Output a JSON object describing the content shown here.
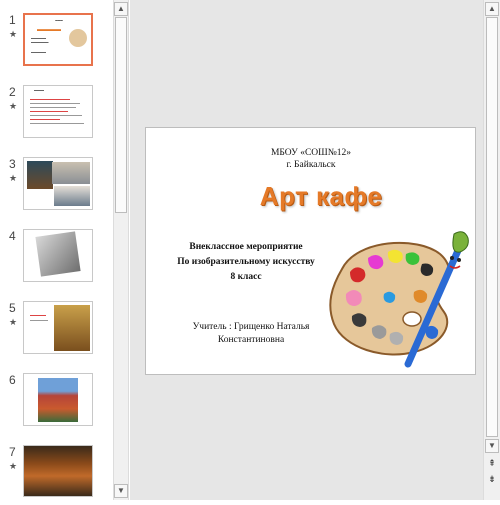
{
  "thumbnails": [
    {
      "number": "1",
      "star": "★",
      "selected": true
    },
    {
      "number": "2",
      "star": "★",
      "selected": false
    },
    {
      "number": "3",
      "star": "★",
      "selected": false
    },
    {
      "number": "4",
      "star": "",
      "selected": false
    },
    {
      "number": "5",
      "star": "★",
      "selected": false
    },
    {
      "number": "6",
      "star": "",
      "selected": false
    },
    {
      "number": "7",
      "star": "★",
      "selected": false
    }
  ],
  "slide": {
    "school_line1": "МБОУ «СОШ№12»",
    "school_line2": "г. Байкальск",
    "title": "Арт кафе",
    "event_line1": "Внеклассное мероприятие",
    "event_line2": "По изобразительному искусству",
    "event_line3": "8 класс",
    "teacher_line1": "Учитель : Грищенко Наталья",
    "teacher_line2": "Константиновна"
  },
  "scrollbar": {
    "up": "▲",
    "down": "▼",
    "prev_slide": "⇞",
    "next_slide": "⇟"
  },
  "colors": {
    "title_orange": "#e57a28",
    "selection_border": "#e8734c",
    "editor_background": "#e6e6e6"
  },
  "icons": {
    "palette_art": "paint-palette-with-brush"
  }
}
